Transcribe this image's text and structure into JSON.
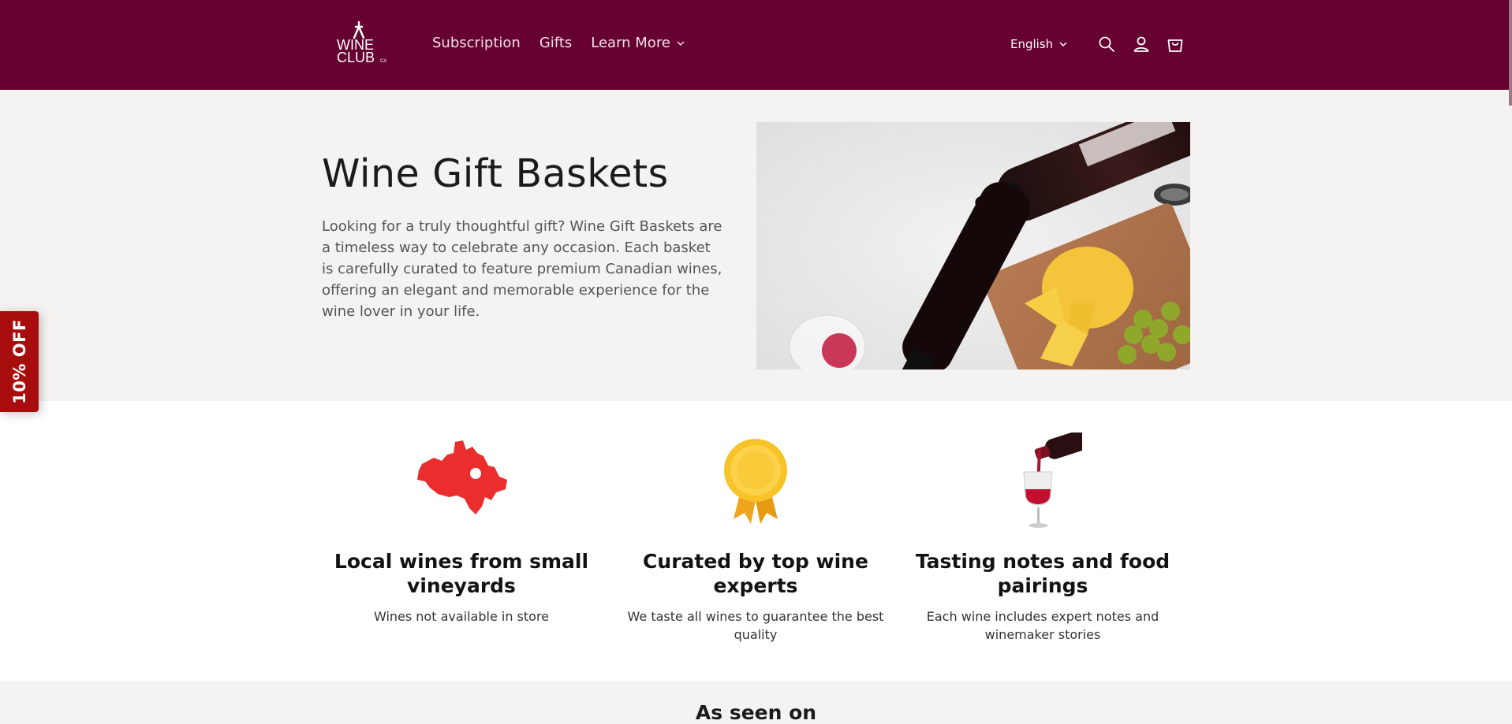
{
  "header": {
    "logo_text_line1": "WINE",
    "logo_text_line2": "CLUB",
    "logo_suffix": "CA",
    "nav": [
      {
        "label": "Subscription"
      },
      {
        "label": "Gifts"
      },
      {
        "label": "Learn More"
      }
    ],
    "language": "English",
    "icons": [
      "search-icon",
      "account-icon",
      "cart-icon"
    ],
    "bg_color": "#650030"
  },
  "hero": {
    "title": "Wine Gift Baskets",
    "text": "Looking for a truly thoughtful gift? Wine Gift Baskets are a timeless way to celebrate any occasion. Each basket is carefully curated to feature premium Canadian wines, offering an elegant and memorable experience for the wine lover in your life."
  },
  "features": [
    {
      "icon": "canada-map-icon",
      "title": "Local wines from small vineyards",
      "text": "Wines not available in store"
    },
    {
      "icon": "award-ribbon-icon",
      "title": "Curated by top wine experts",
      "text": "We taste all wines to guarantee the best quality"
    },
    {
      "icon": "wine-pour-icon",
      "title": "Tasting notes and food pairings",
      "text": "Each wine includes expert notes and winemaker stories"
    }
  ],
  "seen_on": {
    "title": "As seen on"
  },
  "discount_tab": {
    "label": "10% OFF",
    "color": "#a80d0d"
  }
}
